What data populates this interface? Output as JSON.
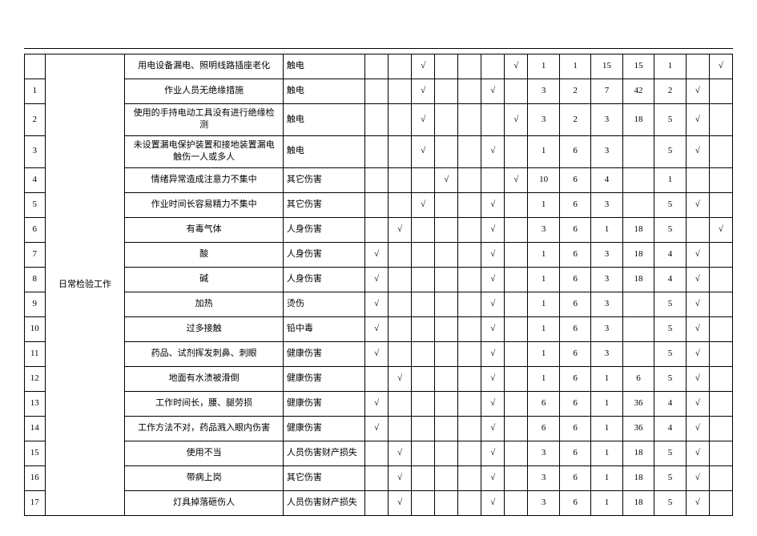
{
  "header": {
    "first_work": "日常检验工作"
  },
  "rows": [
    {
      "idx": "",
      "work": "日常检验工作",
      "desc": "用电设备漏电、照明线路插座老化",
      "type": "触电",
      "chk1": "",
      "chk2": "",
      "chk3": "√",
      "chk4": "",
      "chk5": "",
      "chk6": "",
      "chk7": "√",
      "n1": "1",
      "n2": "1",
      "n3": "15",
      "n4": "15",
      "n5": "1",
      "chk8": "",
      "chk9": "√"
    },
    {
      "idx": "1",
      "desc": "作业人员无绝缘措施",
      "type": "触电",
      "chk1": "",
      "chk2": "",
      "chk3": "√",
      "chk4": "",
      "chk5": "",
      "chk6": "√",
      "chk7": "",
      "n1": "3",
      "n2": "2",
      "n3": "7",
      "n4": "42",
      "n5": "2",
      "chk8": "√",
      "chk9": ""
    },
    {
      "idx": "2",
      "desc": "使用的手持电动工具没有进行绝缘检测",
      "type": "触电",
      "chk1": "",
      "chk2": "",
      "chk3": "√",
      "chk4": "",
      "chk5": "",
      "chk6": "",
      "chk7": "√",
      "n1": "3",
      "n2": "2",
      "n3": "3",
      "n4": "18",
      "n5": "5",
      "chk8": "√",
      "chk9": ""
    },
    {
      "idx": "3",
      "desc": "未设置漏电保护装置和接地装置漏电触伤一人或多人",
      "type": "触电",
      "chk1": "",
      "chk2": "",
      "chk3": "√",
      "chk4": "",
      "chk5": "",
      "chk6": "√",
      "chk7": "",
      "n1": "1",
      "n2": "6",
      "n3": "3",
      "n4": "",
      "n5": "5",
      "chk8": "√",
      "chk9": ""
    },
    {
      "idx": "4",
      "desc": "情绪异常造成注意力不集中",
      "type": "其它伤害",
      "chk1": "",
      "chk2": "",
      "chk3": "",
      "chk4": "√",
      "chk5": "",
      "chk6": "",
      "chk7": "√",
      "n1": "10",
      "n2": "6",
      "n3": "4",
      "n4": "",
      "n5": "1",
      "chk8": "",
      "chk9": ""
    },
    {
      "idx": "5",
      "desc": "作业时间长容易精力不集中",
      "type": "其它伤害",
      "chk1": "",
      "chk2": "",
      "chk3": "√",
      "chk4": "",
      "chk5": "",
      "chk6": "√",
      "chk7": "",
      "n1": "1",
      "n2": "6",
      "n3": "3",
      "n4": "",
      "n5": "5",
      "chk8": "√",
      "chk9": ""
    },
    {
      "idx": "6",
      "desc": "有毒气体",
      "type": "人身伤害",
      "chk1": "",
      "chk2": "√",
      "chk3": "",
      "chk4": "",
      "chk5": "",
      "chk6": "√",
      "chk7": "",
      "n1": "3",
      "n2": "6",
      "n3": "1",
      "n4": "18",
      "n5": "5",
      "chk8": "",
      "chk9": "√"
    },
    {
      "idx": "7",
      "desc": "酸",
      "type": "人身伤害",
      "chk1": "√",
      "chk2": "",
      "chk3": "",
      "chk4": "",
      "chk5": "",
      "chk6": "√",
      "chk7": "",
      "n1": "1",
      "n2": "6",
      "n3": "3",
      "n4": "18",
      "n5": "4",
      "chk8": "√",
      "chk9": ""
    },
    {
      "idx": "8",
      "desc": "碱",
      "type": "人身伤害",
      "chk1": "√",
      "chk2": "",
      "chk3": "",
      "chk4": "",
      "chk5": "",
      "chk6": "√",
      "chk7": "",
      "n1": "1",
      "n2": "6",
      "n3": "3",
      "n4": "18",
      "n5": "4",
      "chk8": "√",
      "chk9": ""
    },
    {
      "idx": "9",
      "desc": "加热",
      "type": "烫伤",
      "chk1": "√",
      "chk2": "",
      "chk3": "",
      "chk4": "",
      "chk5": "",
      "chk6": "√",
      "chk7": "",
      "n1": "1",
      "n2": "6",
      "n3": "3",
      "n4": "",
      "n5": "5",
      "chk8": "√",
      "chk9": ""
    },
    {
      "idx": "10",
      "desc": "过多接触",
      "type": "铅中毒",
      "chk1": "√",
      "chk2": "",
      "chk3": "",
      "chk4": "",
      "chk5": "",
      "chk6": "√",
      "chk7": "",
      "n1": "1",
      "n2": "6",
      "n3": "3",
      "n4": "",
      "n5": "5",
      "chk8": "√",
      "chk9": ""
    },
    {
      "idx": "11",
      "desc": "药品、试剂挥发刺鼻、刺眼",
      "type": "健康伤害",
      "chk1": "√",
      "chk2": "",
      "chk3": "",
      "chk4": "",
      "chk5": "",
      "chk6": "√",
      "chk7": "",
      "n1": "1",
      "n2": "6",
      "n3": "3",
      "n4": "",
      "n5": "5",
      "chk8": "√",
      "chk9": ""
    },
    {
      "idx": "12",
      "desc": "地面有水渍被滑倒",
      "type": "健康伤害",
      "chk1": "",
      "chk2": "√",
      "chk3": "",
      "chk4": "",
      "chk5": "",
      "chk6": "√",
      "chk7": "",
      "n1": "1",
      "n2": "6",
      "n3": "1",
      "n4": "6",
      "n5": "5",
      "chk8": "√",
      "chk9": ""
    },
    {
      "idx": "13",
      "desc": "工作时间长，腰、腿劳损",
      "type": "健康伤害",
      "chk1": "√",
      "chk2": "",
      "chk3": "",
      "chk4": "",
      "chk5": "",
      "chk6": "√",
      "chk7": "",
      "n1": "6",
      "n2": "6",
      "n3": "1",
      "n4": "36",
      "n5": "4",
      "chk8": "√",
      "chk9": ""
    },
    {
      "idx": "14",
      "desc": "工作方法不对，药品溅入眼内伤害",
      "type": "健康伤害",
      "chk1": "√",
      "chk2": "",
      "chk3": "",
      "chk4": "",
      "chk5": "",
      "chk6": "√",
      "chk7": "",
      "n1": "6",
      "n2": "6",
      "n3": "1",
      "n4": "36",
      "n5": "4",
      "chk8": "√",
      "chk9": ""
    },
    {
      "idx": "15",
      "desc": "使用不当",
      "type": "人员伤害财产损失",
      "chk1": "",
      "chk2": "√",
      "chk3": "",
      "chk4": "",
      "chk5": "",
      "chk6": "√",
      "chk7": "",
      "n1": "3",
      "n2": "6",
      "n3": "1",
      "n4": "18",
      "n5": "5",
      "chk8": "√",
      "chk9": ""
    },
    {
      "idx": "16",
      "desc": "带病上岗",
      "type": "其它伤害",
      "chk1": "",
      "chk2": "√",
      "chk3": "",
      "chk4": "",
      "chk5": "",
      "chk6": "√",
      "chk7": "",
      "n1": "3",
      "n2": "6",
      "n3": "1",
      "n4": "18",
      "n5": "5",
      "chk8": "√",
      "chk9": ""
    },
    {
      "idx": "17",
      "desc": "灯具掉落砸伤人",
      "type": "人员伤害财产损失",
      "chk1": "",
      "chk2": "√",
      "chk3": "",
      "chk4": "",
      "chk5": "",
      "chk6": "√",
      "chk7": "",
      "n1": "3",
      "n2": "6",
      "n3": "1",
      "n4": "18",
      "n5": "5",
      "chk8": "√",
      "chk9": ""
    }
  ]
}
